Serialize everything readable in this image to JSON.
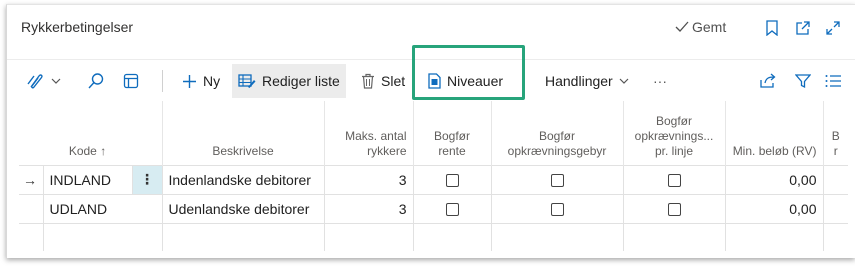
{
  "header": {
    "title": "Rykkerbetingelser",
    "saved_label": "Gemt"
  },
  "toolbar": {
    "new_label": "Ny",
    "edit_list_label": "Rediger liste",
    "delete_label": "Slet",
    "levels_label": "Niveauer",
    "actions_label": "Handlinger",
    "more_label": "···",
    "highlight_color": "#27a47b"
  },
  "table": {
    "columns": {
      "code": "Kode",
      "sort_arrow": "↑",
      "description": "Beskrivelse",
      "max_reminders_1": "Maks. antal",
      "max_reminders_2": "rykkere",
      "post_interest_1": "Bogfør",
      "post_interest_2": "rente",
      "post_fee_1": "Bogfør",
      "post_fee_2": "opkrævningsgebyr",
      "post_fee_line_1": "Bogfør",
      "post_fee_line_2": "opkrævnings...",
      "post_fee_line_3": "pr. linje",
      "min_amount": "Min. beløb (RV)",
      "next_col_1": "B",
      "next_col_2": "r"
    },
    "rows": [
      {
        "indicator": "→",
        "code": "INDLAND",
        "menu": "⋮",
        "description": "Indenlandske debitorer",
        "max_reminders": "3",
        "min_amount": "0,00"
      },
      {
        "indicator": "",
        "code": "UDLAND",
        "menu": "",
        "description": "Udenlandske debitorer",
        "max_reminders": "3",
        "min_amount": "0,00"
      }
    ]
  }
}
